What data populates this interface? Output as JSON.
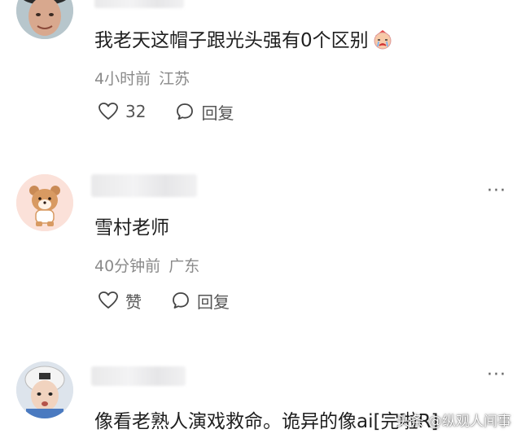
{
  "comments": [
    {
      "text": "我老天这帽子跟光头强有0个区别",
      "time": "4小时前",
      "location": "江苏",
      "likes": "32",
      "reply_label": "回复",
      "emoji_icon": "sad-face-emoji-icon"
    },
    {
      "text": "雪村老师",
      "time": "40分钟前",
      "location": "广东",
      "like_label": "赞",
      "reply_label": "回复",
      "more_label": "···"
    },
    {
      "text": "像看老熟人演戏救命。诡异的像ai[完啦R]",
      "more_label": "···"
    }
  ],
  "watermark": "头条 @纵观人间事"
}
